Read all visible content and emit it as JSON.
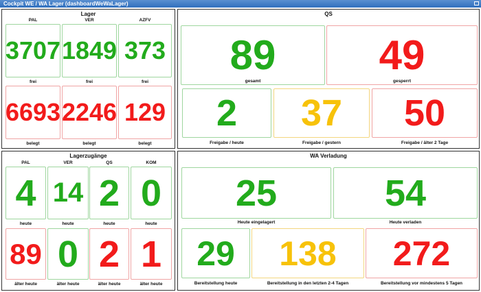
{
  "window": {
    "title": "Cockpit WE / WA Lager (dashboardWeWaLager)"
  },
  "lager": {
    "title": "Lager",
    "columns": [
      "PAL",
      "VER",
      "AZFV"
    ],
    "frei": {
      "label": "frei",
      "values": [
        "3707",
        "1849",
        "373"
      ]
    },
    "belegt": {
      "label": "belegt",
      "values": [
        "6693",
        "2246",
        "129"
      ]
    }
  },
  "qs": {
    "title": "QS",
    "gesamt": {
      "value": "89",
      "label": "gesamt"
    },
    "gesperrt": {
      "value": "49",
      "label": "gesperrt"
    },
    "freigabe_heute": {
      "value": "2",
      "label": "Freigabe / heute"
    },
    "freigabe_gestern": {
      "value": "37",
      "label": "Freigabe / gestern"
    },
    "freigabe_aelter": {
      "value": "50",
      "label": "Freigabe / älter 2 Tage"
    }
  },
  "zugaenge": {
    "title": "Lagerzugänge",
    "columns": [
      "PAL",
      "VER",
      "QS",
      "KOM"
    ],
    "heute": {
      "label": "heute",
      "values": [
        "4",
        "14",
        "2",
        "0"
      ]
    },
    "aelter": {
      "label": "älter heute",
      "values": [
        "89",
        "0",
        "2",
        "1"
      ]
    }
  },
  "wa": {
    "title": "WA Verladung",
    "eingelagert": {
      "value": "25",
      "label": "Heute eingelagert"
    },
    "verladen": {
      "value": "54",
      "label": "Heute verladen"
    },
    "bereit_heute": {
      "value": "29",
      "label": "Bereitstellung heute"
    },
    "bereit_2_4": {
      "value": "138",
      "label": "Bereitstellung in den letzten 2-4 Tagen"
    },
    "bereit_5": {
      "value": "272",
      "label": "Bereitstellung vor mindestens 5 Tagen"
    }
  },
  "colors": {
    "green": "#22ab1c",
    "red": "#f21b1b",
    "yellow": "#f7c20a",
    "titlebar": "#2f6fbd"
  }
}
